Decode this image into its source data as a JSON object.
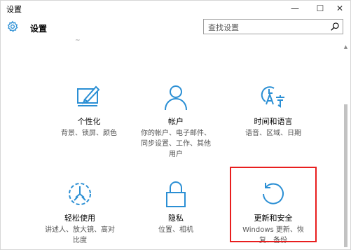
{
  "window": {
    "title": "设置",
    "minimize": "—",
    "maximize": "☐",
    "close": "✕"
  },
  "header": {
    "title": "设置"
  },
  "search": {
    "placeholder": "查找设置"
  },
  "tiles": [
    {
      "name": "个性化",
      "desc_lines": [
        "背景、锁屏、颜色"
      ],
      "icon": "personalization-icon"
    },
    {
      "name": "帐户",
      "desc_lines": [
        "你的帐户、电子邮件、",
        "同步设置、工作、其他",
        "用户"
      ],
      "icon": "account-icon"
    },
    {
      "name": "时间和语言",
      "desc_lines": [
        "语音、区域、日期"
      ],
      "icon": "time-language-icon"
    },
    {
      "name": "轻松使用",
      "desc_lines": [
        "讲述人、放大镜、高对",
        "比度"
      ],
      "icon": "ease-of-access-icon"
    },
    {
      "name": "隐私",
      "desc_lines": [
        "位置、相机"
      ],
      "icon": "privacy-icon"
    },
    {
      "name": "更新和安全",
      "desc_lines": [
        "Windows 更新、恢",
        "复、备份"
      ],
      "icon": "update-security-icon"
    }
  ],
  "colors": {
    "accent": "#2b8fd4",
    "highlight": "#e81e1e"
  },
  "partial_text": "~"
}
